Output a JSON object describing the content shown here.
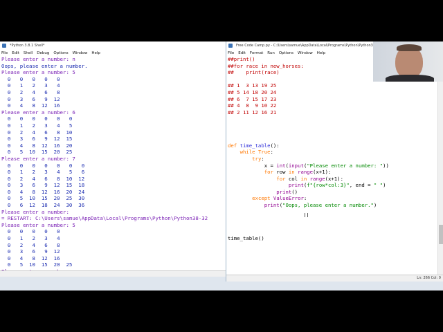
{
  "shell": {
    "title": "*Python 3.8.1 Shell*",
    "menu": [
      "File",
      "Edit",
      "Shell",
      "Debug",
      "Options",
      "Window",
      "Help"
    ],
    "lines": [
      {
        "text": "Please enter a number: n",
        "kind": "prompt"
      },
      {
        "text": "Oops, please enter a number.",
        "kind": "out"
      },
      {
        "text": "Please enter a number: 5",
        "kind": "prompt"
      },
      {
        "text": "  0   0   0   0   0",
        "kind": "out"
      },
      {
        "text": "  0   1   2   3   4",
        "kind": "out"
      },
      {
        "text": "  0   2   4   6   8",
        "kind": "out"
      },
      {
        "text": "  0   3   6   9  12",
        "kind": "out"
      },
      {
        "text": "  0   4   8  12  16",
        "kind": "out"
      },
      {
        "text": "Please enter a number: 6",
        "kind": "prompt"
      },
      {
        "text": "  0   0   0   0   0   0",
        "kind": "out"
      },
      {
        "text": "  0   1   2   3   4   5",
        "kind": "out"
      },
      {
        "text": "  0   2   4   6   8  10",
        "kind": "out"
      },
      {
        "text": "  0   3   6   9  12  15",
        "kind": "out"
      },
      {
        "text": "  0   4   8  12  16  20",
        "kind": "out"
      },
      {
        "text": "  0   5  10  15  20  25",
        "kind": "out"
      },
      {
        "text": "Please enter a number: 7",
        "kind": "prompt"
      },
      {
        "text": "  0   0   0   0   0   0   0",
        "kind": "out"
      },
      {
        "text": "  0   1   2   3   4   5   6",
        "kind": "out"
      },
      {
        "text": "  0   2   4   6   8  10  12",
        "kind": "out"
      },
      {
        "text": "  0   3   6   9  12  15  18",
        "kind": "out"
      },
      {
        "text": "  0   4   8  12  16  20  24",
        "kind": "out"
      },
      {
        "text": "  0   5  10  15  20  25  30",
        "kind": "out"
      },
      {
        "text": "  0   6  12  18  24  30  36",
        "kind": "out"
      },
      {
        "text": "Please enter a number:",
        "kind": "prompt"
      },
      {
        "text": "= RESTART: C:\\Users\\samue\\AppData\\Local\\Programs\\Python\\Python38-32",
        "kind": "restart"
      },
      {
        "text": "Please enter a number: 5",
        "kind": "prompt"
      },
      {
        "text": "  0   0   0   0   0",
        "kind": "out"
      },
      {
        "text": "  0   1   2   3   4",
        "kind": "out"
      },
      {
        "text": "  0   2   4   6   8",
        "kind": "out"
      },
      {
        "text": "  0   3   6   9  12",
        "kind": "out"
      },
      {
        "text": "  0   4   8  12  16",
        "kind": "out"
      },
      {
        "text": "  0   5  10  15  20  25",
        "kind": "out"
      },
      {
        "text": "Please enter a number:",
        "kind": "prompt"
      }
    ]
  },
  "editor": {
    "title": "Free Code Camp.py - C:\\Users\\samue\\AppData\\Local\\Programs\\Python\\Python38-32",
    "menu": [
      "File",
      "Edit",
      "Format",
      "Run",
      "Options",
      "Window",
      "Help"
    ],
    "status": "Ln: 266   Col: 0",
    "code": [
      [
        [
          "##print()",
          "cm"
        ]
      ],
      [
        [
          "##for race in new_horses:",
          "cm"
        ]
      ],
      [
        [
          "##    print(race)",
          "cm"
        ]
      ],
      [
        [
          "",
          "df"
        ]
      ],
      [
        [
          "## 1  3 13 19 25",
          "cm"
        ]
      ],
      [
        [
          "## 5 14 18 20 24",
          "cm"
        ]
      ],
      [
        [
          "## 6  7 15 17 23",
          "cm"
        ]
      ],
      [
        [
          "## 4  8  9 10 22",
          "cm"
        ]
      ],
      [
        [
          "## 2 11 12 16 21",
          "cm"
        ]
      ],
      [
        [
          "",
          "df"
        ]
      ],
      [
        [
          "",
          "df"
        ]
      ],
      [
        [
          "",
          "df"
        ]
      ],
      [
        [
          "",
          "df"
        ]
      ],
      [
        [
          "def ",
          "kw"
        ],
        [
          "time_table",
          "fn"
        ],
        [
          "():",
          "df"
        ]
      ],
      [
        [
          "    ",
          "df"
        ],
        [
          "while ",
          "kw"
        ],
        [
          "True",
          "kw"
        ],
        [
          ":",
          "df"
        ]
      ],
      [
        [
          "        ",
          "df"
        ],
        [
          "try",
          "kw"
        ],
        [
          ":",
          "df"
        ]
      ],
      [
        [
          "            x = ",
          "df"
        ],
        [
          "int",
          "bi"
        ],
        [
          "(",
          "df"
        ],
        [
          "input",
          "bi"
        ],
        [
          "(",
          "df"
        ],
        [
          "\"Please enter a number: \"",
          "st"
        ],
        [
          "))",
          "df"
        ]
      ],
      [
        [
          "            ",
          "df"
        ],
        [
          "for ",
          "kw"
        ],
        [
          "row ",
          "df"
        ],
        [
          "in ",
          "kw"
        ],
        [
          "range",
          "bi"
        ],
        [
          "(x+1):",
          "df"
        ]
      ],
      [
        [
          "                ",
          "df"
        ],
        [
          "for ",
          "kw"
        ],
        [
          "col ",
          "df"
        ],
        [
          "in ",
          "kw"
        ],
        [
          "range",
          "bi"
        ],
        [
          "(x+1):",
          "df"
        ]
      ],
      [
        [
          "                    ",
          "df"
        ],
        [
          "print",
          "bi"
        ],
        [
          "(",
          "df"
        ],
        [
          "f\"{row*col:3}\"",
          "st"
        ],
        [
          ", end = ",
          "df"
        ],
        [
          "\" \"",
          "st"
        ],
        [
          ")",
          "df"
        ]
      ],
      [
        [
          "                ",
          "df"
        ],
        [
          "print",
          "bi"
        ],
        [
          "()",
          "df"
        ]
      ],
      [
        [
          "        ",
          "df"
        ],
        [
          "except ",
          "kw"
        ],
        [
          "ValueError",
          "bi"
        ],
        [
          ":",
          "df"
        ]
      ],
      [
        [
          "            ",
          "df"
        ],
        [
          "print",
          "bi"
        ],
        [
          "(",
          "df"
        ],
        [
          "\"Oops, please enter a number.\"",
          "st"
        ],
        [
          ")",
          "df"
        ]
      ],
      [
        [
          "",
          "df"
        ]
      ],
      [
        [
          "",
          "df"
        ]
      ],
      [
        [
          "",
          "df"
        ]
      ],
      [
        [
          "",
          "df"
        ]
      ],
      [
        [
          "time_table()",
          "df"
        ]
      ]
    ]
  }
}
